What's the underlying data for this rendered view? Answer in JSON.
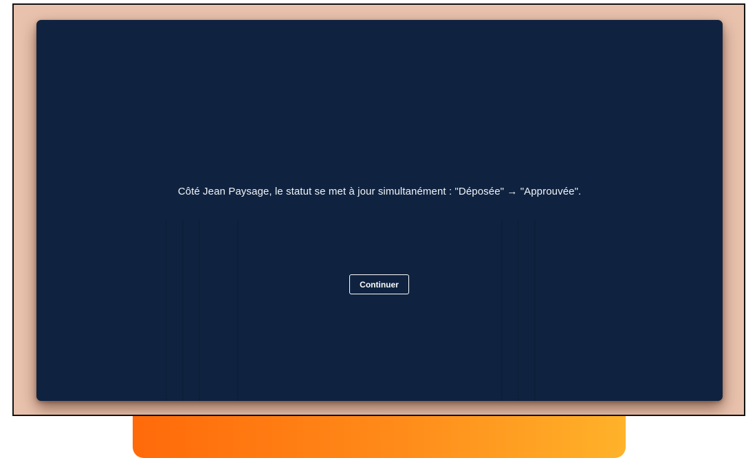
{
  "dialog": {
    "message": "Côté Jean Paysage, le statut se met à jour simultanément : \"Déposée\" → \"Approuvée\".",
    "continue_label": "Continuer"
  },
  "colors": {
    "card_background": "#0f2340",
    "frame_background": "#e9c2ad",
    "accent_gradient_start": "#ff6a0a",
    "accent_gradient_end": "#ffb22a",
    "text": "#f2f4f8"
  }
}
